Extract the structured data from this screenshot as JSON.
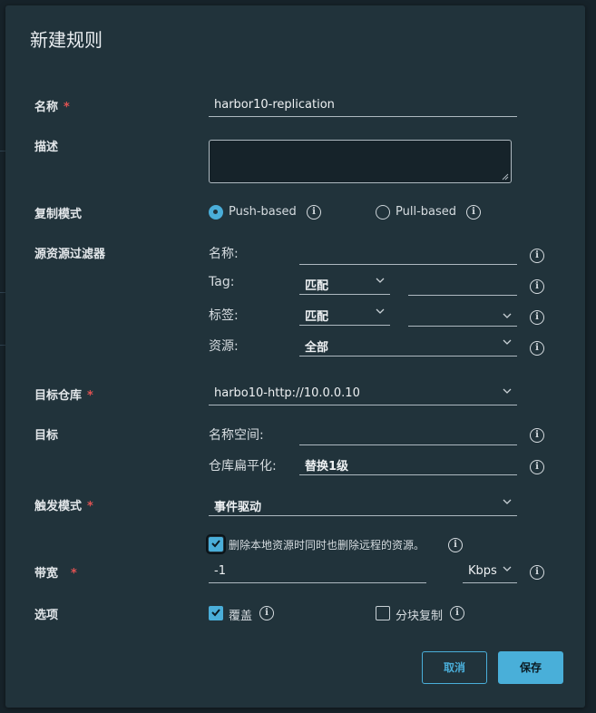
{
  "dialog": {
    "title": "新建规则"
  },
  "required_mark": "*",
  "form": {
    "name": {
      "label": "名称",
      "value": "harbor10-replication"
    },
    "description": {
      "label": "描述",
      "value": ""
    },
    "mode": {
      "label": "复制模式",
      "push": "Push-based",
      "pull": "Pull-based",
      "selected": "push"
    },
    "source_filter": {
      "label": "源资源过滤器",
      "name_label": "名称:",
      "name_value": "",
      "tag_label": "Tag:",
      "tag_match": "匹配",
      "tag_value": "",
      "labels_label": "标签:",
      "labels_match": "匹配",
      "labels_value": "",
      "resource_label": "资源:",
      "resource_value": "全部"
    },
    "target_registry": {
      "label": "目标仓库",
      "value": "harbo10-http://10.0.0.10"
    },
    "target": {
      "label": "目标",
      "namespace_label": "名称空间:",
      "namespace_value": "",
      "flatten_label": "仓库扁平化:",
      "flatten_value": "替换1级"
    },
    "trigger": {
      "label": "触发模式",
      "value": "事件驱动",
      "delete_remote_text": "删除本地资源时同时也删除远程的资源。",
      "delete_remote_checked": true
    },
    "bandwidth": {
      "label": "带宽",
      "value": "-1",
      "unit": "Kbps"
    },
    "options": {
      "label": "选项",
      "override": "覆盖",
      "override_checked": true,
      "chunk": "分块复制",
      "chunk_checked": false
    }
  },
  "buttons": {
    "cancel": "取消",
    "save": "保存"
  },
  "icons": {
    "info": "info-icon",
    "chevron": "chevron-down-icon",
    "check": "check-icon"
  },
  "colors": {
    "accent": "#49afd9",
    "required": "#e05252",
    "background": "#21333b"
  }
}
